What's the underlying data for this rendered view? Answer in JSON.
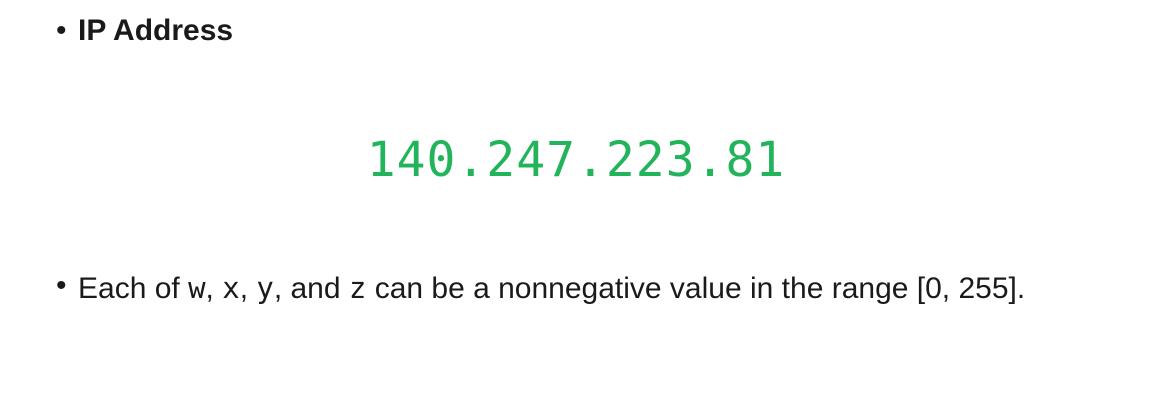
{
  "heading": {
    "bullet": "•",
    "text": "IP Address"
  },
  "ip": {
    "value": "140.247.223.81",
    "color": "#22b45a"
  },
  "description": {
    "bullet": "•",
    "prefix": "Each of ",
    "var_w": "w",
    "sep1": ", ",
    "var_x": "x",
    "sep2": ", ",
    "var_y": "y",
    "sep3": ", and ",
    "var_z": "z",
    "suffix": " can be a nonnegative value in the range [0, 255]."
  }
}
